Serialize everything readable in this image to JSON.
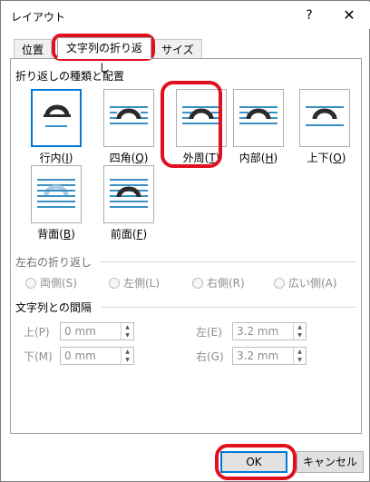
{
  "window": {
    "title": "レイアウト",
    "help_glyph": "?",
    "close_glyph": "✕"
  },
  "tabs": [
    {
      "label": "位置"
    },
    {
      "label": "文字列の折り返し",
      "selected": true
    },
    {
      "label": "サイズ"
    }
  ],
  "wrap_section": {
    "title": "折り返しの種類と配置",
    "options": [
      {
        "label": "行内(",
        "key": "I",
        "suffix": ")",
        "icon": "inline-icon",
        "selected": true
      },
      {
        "label": "四角(",
        "key": "Q",
        "suffix": ")",
        "icon": "square-icon"
      },
      {
        "label": "外周(",
        "key": "T",
        "suffix": ")",
        "icon": "tight-icon"
      },
      {
        "label": "内部(",
        "key": "H",
        "suffix": ")",
        "icon": "through-icon"
      },
      {
        "label": "上下(",
        "key": "O",
        "suffix": ")",
        "icon": "top-bottom-icon"
      },
      {
        "label": "背面(",
        "key": "B",
        "suffix": ")",
        "icon": "behind-text-icon"
      },
      {
        "label": "前面(",
        "key": "F",
        "suffix": ")",
        "icon": "in-front-icon"
      }
    ]
  },
  "side_section": {
    "title": "左右の折り返し",
    "options": [
      {
        "label": "両側(S)"
      },
      {
        "label": "左側(L)"
      },
      {
        "label": "右側(R)"
      },
      {
        "label": "広い側(A)"
      }
    ]
  },
  "distance_section": {
    "title": "文字列との間隔",
    "top": {
      "label": "上(P)",
      "value": "0 mm"
    },
    "bottom": {
      "label": "下(M)",
      "value": "0 mm"
    },
    "left": {
      "label": "左(E)",
      "value": "3.2 mm"
    },
    "right": {
      "label": "右(G)",
      "value": "3.2 mm"
    }
  },
  "footer": {
    "ok_label": "OK",
    "cancel_label": "キャンセル"
  },
  "colors": {
    "accent": "#0078d7",
    "highlight": "#e0101e",
    "icon_dark": "#2b2b2b",
    "icon_line": "#3a8fc4"
  }
}
